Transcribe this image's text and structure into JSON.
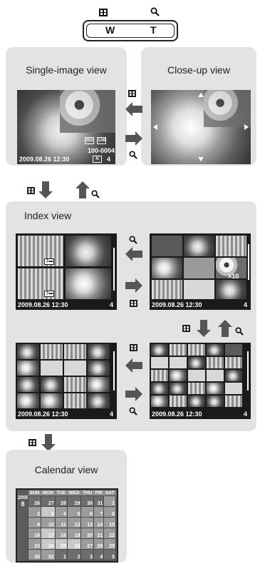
{
  "zoom_lever": {
    "wide_label": "W",
    "tele_label": "T"
  },
  "panels": {
    "single_title": "Single-image view",
    "closeup_title": "Close-up view",
    "index_title": "Index view",
    "calendar_title": "Calendar view"
  },
  "single_screen": {
    "file_number": "100-0004",
    "count": "4",
    "datetime": "2009.08.26  12:30",
    "quality": "N",
    "size_icon": "12M",
    "counter_icon": "ISO"
  },
  "index_screens": {
    "s4": {
      "datetime": "2009.08.26  12:30",
      "count": "4"
    },
    "s9": {
      "datetime": "2009.08.26  12:30",
      "count": "4",
      "print_count": "×10"
    },
    "s16": {
      "datetime": "2009.08.26  12:30",
      "count": "4"
    },
    "s25": {
      "datetime": "2009.08.26  12:30",
      "count": "4"
    }
  },
  "calendar": {
    "year": "2009",
    "month": "8",
    "days": [
      "SUN",
      "MON",
      "TUE",
      "WED",
      "THU",
      "FRI",
      "SAT"
    ],
    "weeks": [
      [
        "26",
        "27",
        "28",
        "29",
        "30",
        "31",
        "1"
      ],
      [
        "2",
        "3",
        "4",
        "5",
        "6",
        "7",
        "8"
      ],
      [
        "9",
        "10",
        "11",
        "12",
        "13",
        "14",
        "15"
      ],
      [
        "16",
        "17",
        "18",
        "19",
        "20",
        "21",
        "22"
      ],
      [
        "23",
        "24",
        "25",
        "26",
        "27",
        "28",
        "29"
      ],
      [
        "30",
        "31",
        "1",
        "2",
        "3",
        "4",
        "5"
      ]
    ],
    "photo_days": [
      "3",
      "17",
      "24",
      "25",
      "26"
    ]
  },
  "icons": {
    "zoom_out": "index-grid-icon",
    "zoom_in": "magnifier-icon",
    "protect": "key-icon",
    "print": "print-icon"
  }
}
